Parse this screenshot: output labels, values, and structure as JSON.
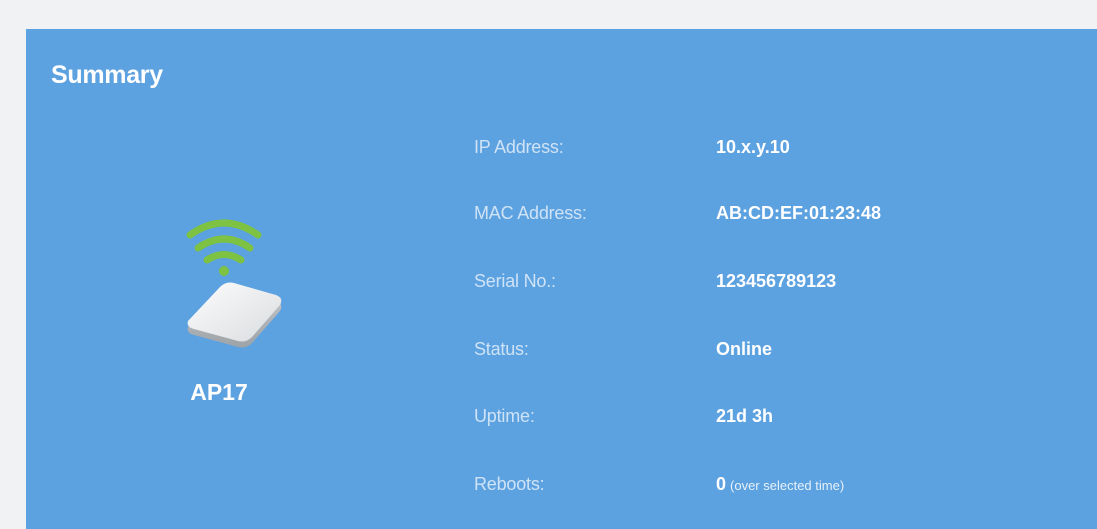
{
  "summary": {
    "title": "Summary",
    "device": {
      "name": "AP17",
      "icon": "wireless-access-point-icon"
    },
    "fields": [
      {
        "label": "IP Address:",
        "value": "10.x.y.10"
      },
      {
        "label": "MAC Address:",
        "value": "AB:CD:EF:01:23:48"
      },
      {
        "label": "Serial No.:",
        "value": "123456789123"
      },
      {
        "label": "Status:",
        "value": "Online"
      },
      {
        "label": "Uptime:",
        "value": "21d 3h"
      },
      {
        "label": "Reboots:",
        "value": "0",
        "note": "(over selected time)"
      }
    ]
  },
  "colors": {
    "page_background": "#f0f2f4",
    "card_background": "#5ca1e0",
    "wifi_signal": "#7dc242",
    "label_text": "#cfe3f6",
    "value_text": "#ffffff"
  }
}
